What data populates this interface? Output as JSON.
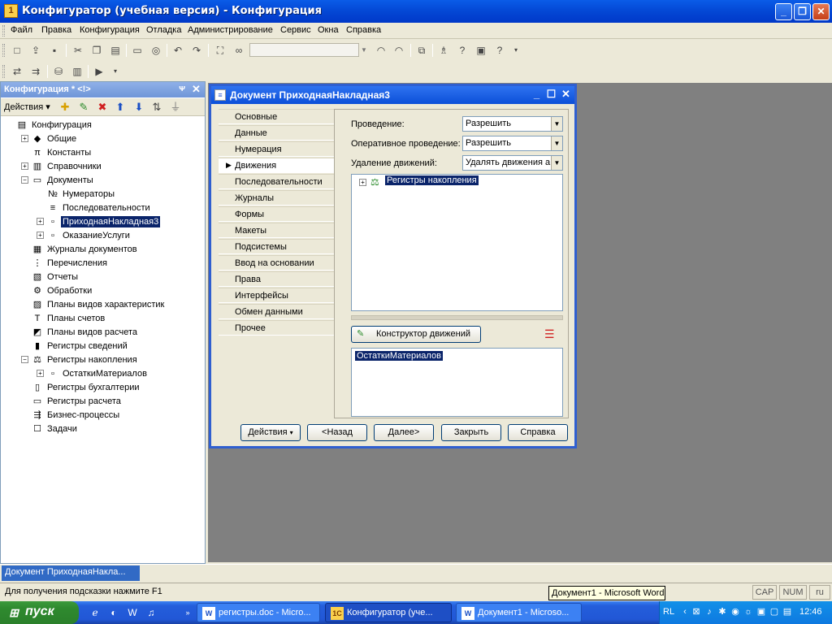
{
  "window": {
    "title": "Конфигуратор (учебная версия) - Конфигурация",
    "icon": "1c-app-icon"
  },
  "window_buttons": {
    "minimize": "_",
    "maximize": "❐",
    "close": "✕"
  },
  "menu": [
    "Файл",
    "Правка",
    "Конфигурация",
    "Отладка",
    "Администрирование",
    "Сервис",
    "Окна",
    "Справка"
  ],
  "toolbar1_icons": [
    "new-icon",
    "open-icon",
    "save-icon",
    "cut-icon",
    "copy-icon",
    "paste-icon",
    "print-icon",
    "preview-icon",
    "undo-icon",
    "redo-icon",
    "find-icon",
    "find-next-icon",
    "search-combo",
    "search-prev-icon",
    "search-next-icon",
    "window-icon",
    "wizard-icon",
    "help-icon",
    "syntax-helper-icon",
    "1c-help-icon"
  ],
  "config_panel": {
    "title": "Конфигурация * <!>",
    "pin": "ᴪ",
    "close": "✕",
    "actions_label": "Действия ▾",
    "tree": [
      {
        "label": "Конфигурация",
        "icon": "config-icon",
        "depth": 0,
        "exp": ""
      },
      {
        "label": "Общие",
        "icon": "common-icon",
        "depth": 1,
        "exp": "+"
      },
      {
        "label": "Константы",
        "icon": "constants-icon",
        "depth": 1,
        "exp": ""
      },
      {
        "label": "Справочники",
        "icon": "catalogs-icon",
        "depth": 1,
        "exp": "+"
      },
      {
        "label": "Документы",
        "icon": "documents-icon",
        "depth": 1,
        "exp": "−"
      },
      {
        "label": "Нумераторы",
        "icon": "numerators-icon",
        "depth": 2,
        "exp": ""
      },
      {
        "label": "Последовательности",
        "icon": "sequences-icon",
        "depth": 2,
        "exp": ""
      },
      {
        "label": "ПриходнаяНакладная3",
        "icon": "document-icon",
        "depth": 2,
        "exp": "+",
        "selected": true
      },
      {
        "label": "ОказаниеУслуги",
        "icon": "document-icon",
        "depth": 2,
        "exp": "+"
      },
      {
        "label": "Журналы документов",
        "icon": "journals-icon",
        "depth": 1,
        "exp": ""
      },
      {
        "label": "Перечисления",
        "icon": "enums-icon",
        "depth": 1,
        "exp": ""
      },
      {
        "label": "Отчеты",
        "icon": "reports-icon",
        "depth": 1,
        "exp": ""
      },
      {
        "label": "Обработки",
        "icon": "processing-icon",
        "depth": 1,
        "exp": ""
      },
      {
        "label": "Планы видов характеристик",
        "icon": "char-plans-icon",
        "depth": 1,
        "exp": ""
      },
      {
        "label": "Планы счетов",
        "icon": "accounts-icon",
        "depth": 1,
        "exp": ""
      },
      {
        "label": "Планы видов расчета",
        "icon": "calc-plans-icon",
        "depth": 1,
        "exp": ""
      },
      {
        "label": "Регистры сведений",
        "icon": "info-registers-icon",
        "depth": 1,
        "exp": ""
      },
      {
        "label": "Регистры накопления",
        "icon": "accum-registers-icon",
        "depth": 1,
        "exp": "−"
      },
      {
        "label": "ОстаткиМатериалов",
        "icon": "register-icon",
        "depth": 2,
        "exp": "+"
      },
      {
        "label": "Регистры бухгалтерии",
        "icon": "acc-registers-icon",
        "depth": 1,
        "exp": ""
      },
      {
        "label": "Регистры расчета",
        "icon": "calc-registers-icon",
        "depth": 1,
        "exp": ""
      },
      {
        "label": "Бизнес-процессы",
        "icon": "bp-icon",
        "depth": 1,
        "exp": ""
      },
      {
        "label": "Задачи",
        "icon": "tasks-icon",
        "depth": 1,
        "exp": ""
      }
    ]
  },
  "doc_window": {
    "title": "Документ ПриходнаяНакладная3",
    "tabs": [
      "Основные",
      "Данные",
      "Нумерация",
      "Движения",
      "Последовательности",
      "Журналы",
      "Формы",
      "Макеты",
      "Подсистемы",
      "Ввод на основании",
      "Права",
      "Интерфейсы",
      "Обмен данными",
      "Прочее"
    ],
    "active_tab": "Движения",
    "fields": [
      {
        "label": "Проведение:",
        "value": "Разрешить"
      },
      {
        "label": "Оперативное проведение:",
        "value": "Разрешить"
      },
      {
        "label": "Удаление движений:",
        "value": "Удалять движения а"
      }
    ],
    "registers_tree_item": "Регистры накопления",
    "constructor_button": "Конструктор движений",
    "selected_registers": [
      "ОстаткиМатериалов"
    ],
    "buttons": {
      "actions": "Действия",
      "back": "<Назад",
      "next": "Далее>",
      "close": "Закрыть",
      "help": "Справка"
    }
  },
  "mdi_tab": "Документ ПриходнаяНакла...",
  "status": {
    "text": "Для получения подсказки нажмите F1",
    "caps": "CAP",
    "num": "NUM",
    "lang": "ru"
  },
  "tooltip": "Документ1 - Microsoft Word",
  "taskbar": {
    "start": "пуск",
    "quicklaunch": [
      "ie-icon",
      "browser-icon",
      "word-icon",
      "media-icon"
    ],
    "tasks": [
      {
        "label": "регистры.doc - Micro...",
        "icon": "W",
        "active": false
      },
      {
        "label": "Конфигуратор (уче...",
        "icon": "1C",
        "active": true
      },
      {
        "label": "Документ1 - Microso...",
        "icon": "W",
        "active": false
      }
    ],
    "lang": "RL",
    "clock": "12:46"
  }
}
